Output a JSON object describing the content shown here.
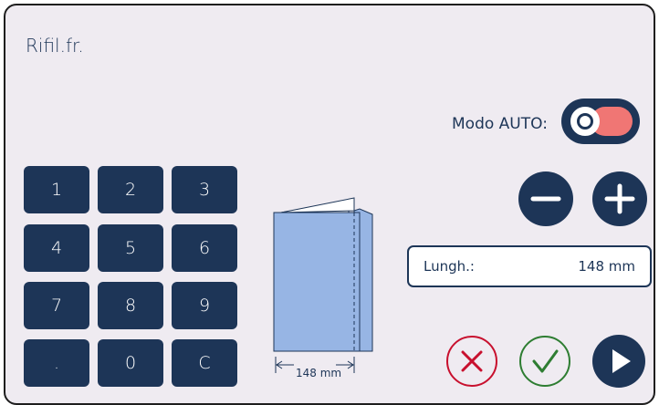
{
  "header": {
    "title": "Rifil.fr."
  },
  "auto_mode": {
    "label": "Modo AUTO:",
    "enabled": true,
    "accent": "#f07674"
  },
  "keypad": {
    "keys": [
      "1",
      "2",
      "3",
      "4",
      "5",
      "6",
      "7",
      "8",
      "9",
      ".",
      "0",
      "C"
    ]
  },
  "length": {
    "label": "Lungh.:",
    "value": "148 mm"
  },
  "preview": {
    "dimension_label": "148 mm"
  },
  "buttons": {
    "decrease": "minus-icon",
    "increase": "plus-icon",
    "cancel": "close-icon",
    "confirm": "check-icon",
    "start": "play-icon"
  },
  "colors": {
    "primary": "#1d3557",
    "background": "#efebf1",
    "cancel": "#c8102e",
    "confirm": "#2e7d32",
    "paper": "#97b5e4"
  }
}
